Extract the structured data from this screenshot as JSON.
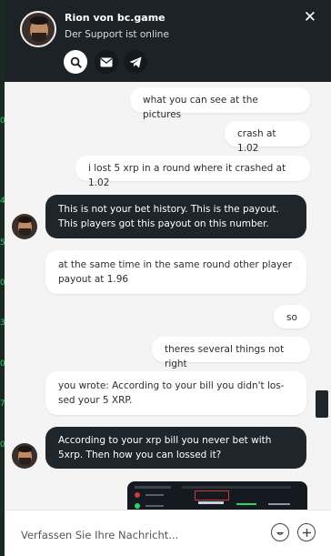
{
  "header": {
    "title": "Rion von bc.game",
    "status": "Der Support ist online",
    "close_glyph": "✕",
    "buttons": [
      {
        "icon": "search-icon",
        "active": true
      },
      {
        "icon": "mail-icon",
        "active": false
      },
      {
        "icon": "telegram-icon",
        "active": false
      }
    ]
  },
  "messages": [
    {
      "sender": "user",
      "text": "what you can see at the pictures"
    },
    {
      "sender": "user",
      "text": "crash at 1.02"
    },
    {
      "sender": "user",
      "text": "i lost 5 xrp in a round where it crashed at 1.02"
    },
    {
      "sender": "agent",
      "text": "This is not your bet history. This is the payout. This players got this payout on this number."
    },
    {
      "sender": "user",
      "text": "at the same time in the same round other player payout at 1.96"
    },
    {
      "sender": "user",
      "text": "so"
    },
    {
      "sender": "user",
      "text": "theres several things not right"
    },
    {
      "sender": "user",
      "text": "you wrote: According to your bill you didn't los-sed your 5 XRP."
    },
    {
      "sender": "agent",
      "text": "According to your xrp bill you never bet with 5xrp. Then how you can lossed it?"
    }
  ],
  "composer": {
    "placeholder": "Verfassen Sie Ihre Nachricht..."
  },
  "colors": {
    "header_bg": "#1d2226",
    "agent_bubble": "#1f262b",
    "user_bubble": "#ffffff",
    "chat_bg": "#f4f4f4",
    "accent_green": "#2bd46a"
  }
}
